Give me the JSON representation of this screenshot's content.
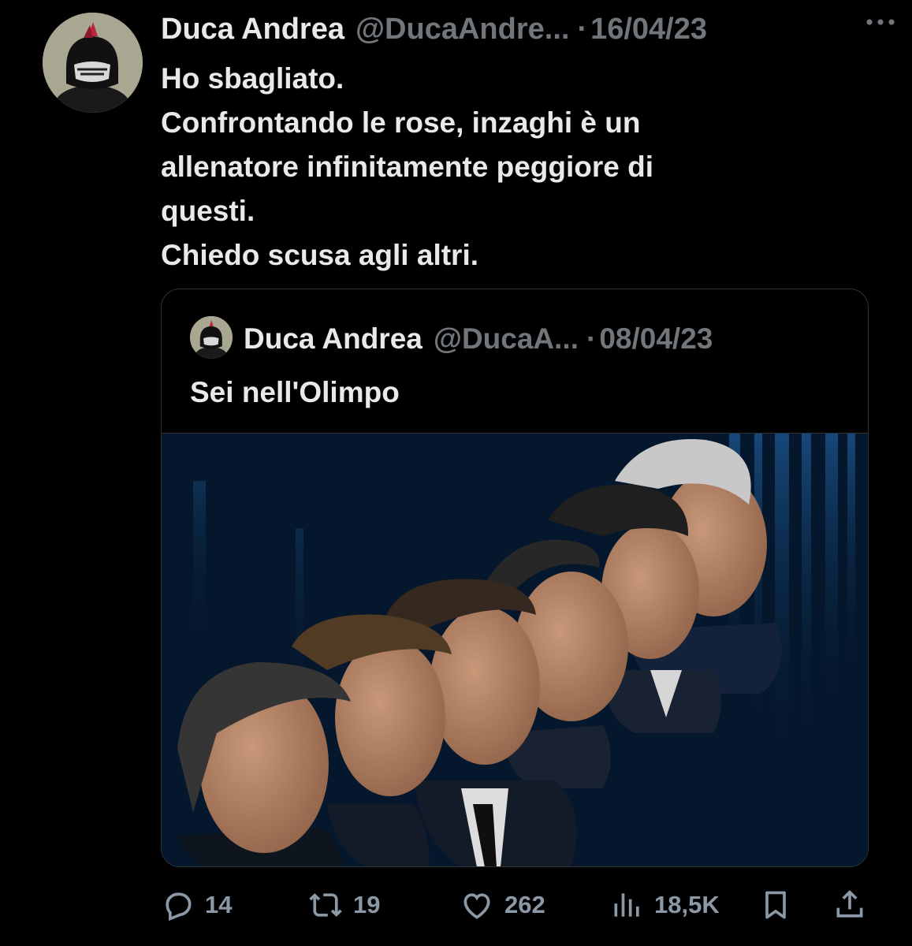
{
  "tweet": {
    "display_name": "Duca Andrea",
    "handle": "@DucaAndre...",
    "separator": "·",
    "date": "16/04/23",
    "text_lines": [
      "Ho sbagliato.",
      "Confrontando le rose, inzaghi è un",
      "allenatore infinitamente peggiore di",
      "questi.",
      "Chiedo scusa agli altri."
    ]
  },
  "quoted": {
    "display_name": "Duca Andrea",
    "handle": "@DucaA...",
    "separator": "·",
    "date": "08/04/23",
    "text": "Sei nell'Olimpo"
  },
  "actions": {
    "replies": "14",
    "retweets": "19",
    "likes": "262",
    "views": "18,5K"
  },
  "icons": {
    "more": "more-horizontal-icon",
    "reply": "reply-icon",
    "retweet": "retweet-icon",
    "like": "heart-icon",
    "views": "views-icon",
    "bookmark": "bookmark-icon",
    "share": "share-icon"
  },
  "colors": {
    "background": "#000000",
    "text_primary": "#e7e9ea",
    "text_secondary": "#71767b",
    "action_gray": "#8b98a5",
    "border": "#2f3336"
  }
}
